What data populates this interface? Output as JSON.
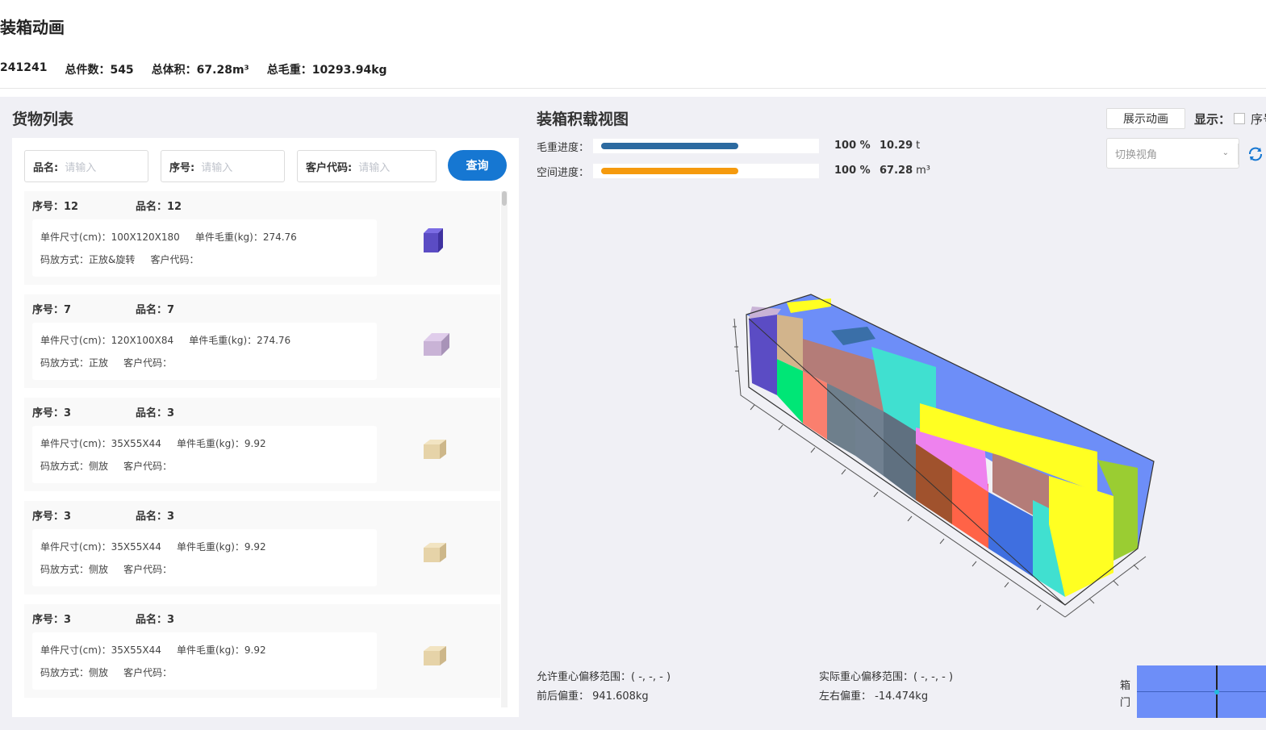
{
  "page": {
    "title": "装箱动画",
    "summary": {
      "id": "241241",
      "total_pieces": "总件数：545",
      "total_volume": "总体积：67.28m³",
      "total_weight": "总毛重：10293.94kg"
    }
  },
  "cargo": {
    "title": "货物列表",
    "search": {
      "name_label": "品名:",
      "name_placeholder": "请输入",
      "seq_label": "序号:",
      "seq_placeholder": "请输入",
      "customer_label": "客户代码:",
      "customer_placeholder": "请输入",
      "query_label": "查询"
    },
    "items": [
      {
        "seq": "序号：12",
        "name": "品名：12",
        "size": "单件尺寸(cm)：100X120X180",
        "weight": "单件毛重(kg)：274.76",
        "placement": "码放方式：正放&旋转",
        "customer": "客户代码：",
        "color": "#5b4cc4",
        "icon": "box-icon"
      },
      {
        "seq": "序号：7",
        "name": "品名：7",
        "size": "单件尺寸(cm)：120X100X84",
        "weight": "单件毛重(kg)：274.76",
        "placement": "码放方式：正放",
        "customer": "客户代码：",
        "color": "#c9b3d6",
        "icon": "box-icon"
      },
      {
        "seq": "序号：3",
        "name": "品名：3",
        "size": "单件尺寸(cm)：35X55X44",
        "weight": "单件毛重(kg)：9.92",
        "placement": "码放方式：侧放",
        "customer": "客户代码：",
        "color": "#e6d3a8",
        "icon": "box-icon"
      },
      {
        "seq": "序号：3",
        "name": "品名：3",
        "size": "单件尺寸(cm)：35X55X44",
        "weight": "单件毛重(kg)：9.92",
        "placement": "码放方式：侧放",
        "customer": "客户代码：",
        "color": "#e6d3a8",
        "icon": "box-icon"
      },
      {
        "seq": "序号：3",
        "name": "品名：3",
        "size": "单件尺寸(cm)：35X55X44",
        "weight": "单件毛重(kg)：9.92",
        "placement": "码放方式：侧放",
        "customer": "客户代码：",
        "color": "#e6d3a8",
        "icon": "box-icon"
      }
    ]
  },
  "loading": {
    "title": "装箱积载视图",
    "weight_progress": {
      "label": "毛重进度：",
      "percent": "100 %",
      "value": "10.29",
      "unit": "t",
      "fraction": 1.0,
      "color": "#2c6aa0"
    },
    "space_progress": {
      "label": "空间进度：",
      "percent": "100 %",
      "value": "67.28",
      "unit": "m³",
      "fraction": 1.0,
      "color": "#f59a0e"
    },
    "animate_button": "展示动画",
    "display_label": "显示：",
    "checkbox_label": "序号",
    "view_select_placeholder": "切换视角",
    "refresh_icon": "refresh-icon",
    "cg": {
      "allowed_range": "允许重心偏移范围：( -, -, - )",
      "actual_range": "实际重心偏移范围：( -, -, - )",
      "front_back": "前后偏重： 941.608kg",
      "left_right": "左右偏重： -14.474kg"
    },
    "door_label_top": "箱",
    "door_label_bottom": "门"
  }
}
